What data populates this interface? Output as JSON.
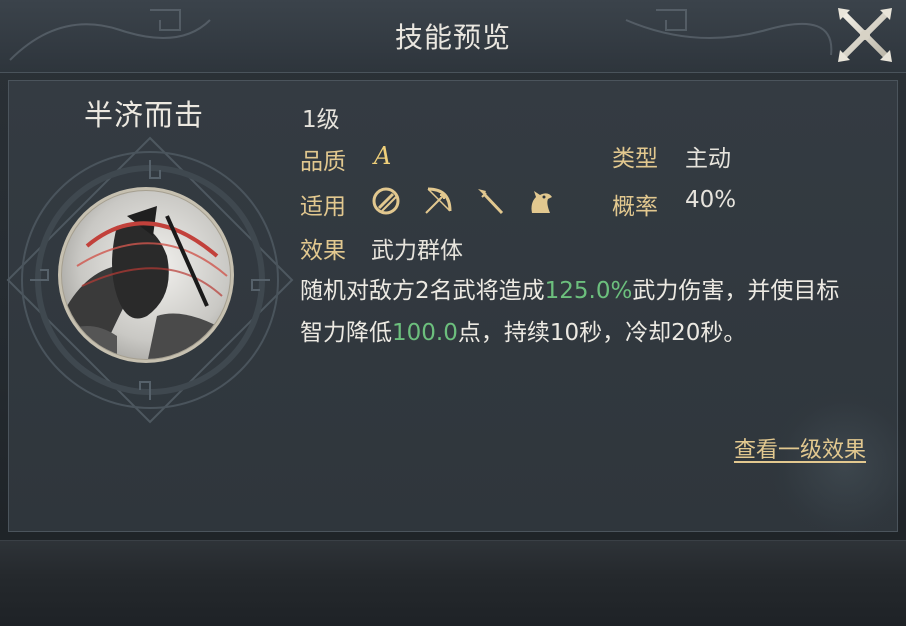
{
  "header": {
    "title": "技能预览",
    "close_icon": "close-x-icon"
  },
  "skill": {
    "name": "半济而击",
    "level": "1级",
    "quality_label": "品质",
    "quality_value": "A",
    "type_label": "类型",
    "type_value": "主动",
    "applies_label": "适用",
    "applies_icons": [
      "shield-icon",
      "bow-icon",
      "spear-icon",
      "horse-icon"
    ],
    "rate_label": "概率",
    "rate_value": "40%",
    "effect_label": "效果",
    "effect_value": "武力群体",
    "description": {
      "p1": "随机对敌方2名武将造成",
      "v1": "125.0%",
      "p2": "武力伤害，并使目标智力降低",
      "v2": "100.0",
      "p3": "点，持续10秒，冷却20秒。"
    },
    "view_level_one_link": "查看一级效果"
  },
  "colors": {
    "label_gold": "#e2c88f",
    "highlight_green": "#6cbf7d",
    "text_light": "#e6e3dc"
  }
}
